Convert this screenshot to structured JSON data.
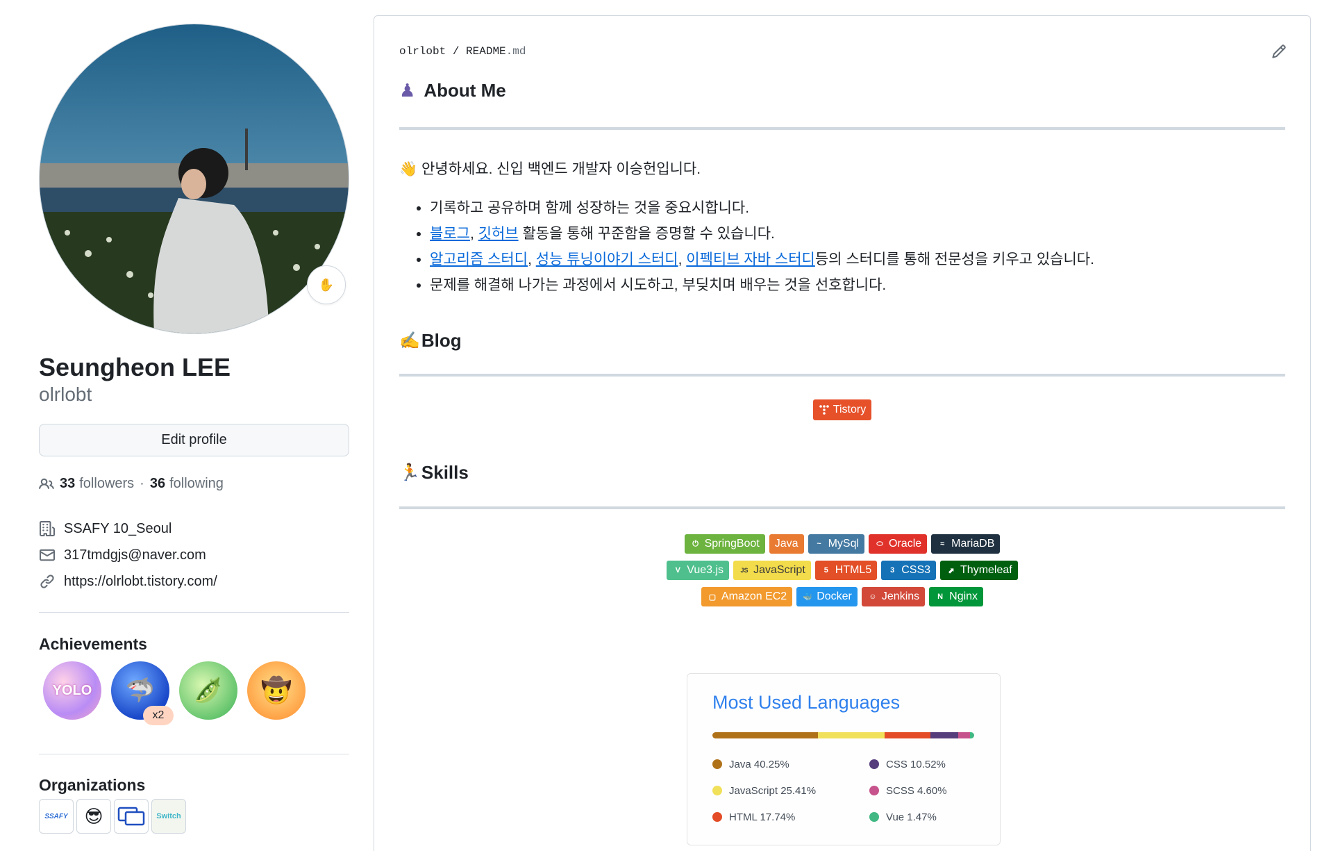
{
  "profile": {
    "full_name": "Seungheon LEE",
    "username": "olrlobt",
    "status_emoji": "✋",
    "edit_label": "Edit profile",
    "followers_count": "33",
    "followers_label": "followers",
    "separator": "·",
    "following_count": "36",
    "following_label": "following",
    "company": "SSAFY 10_Seoul",
    "email": "317tmdgjs@naver.com",
    "website": "https://olrlobt.tistory.com/"
  },
  "achievements": {
    "title": "Achievements",
    "items": [
      {
        "name": "yolo",
        "text": "YOLO"
      },
      {
        "name": "pull-shark",
        "text": "🦈",
        "count": "x2"
      },
      {
        "name": "pair-extraordinaire",
        "text": "🫛"
      },
      {
        "name": "quickdraw",
        "text": "🤠"
      }
    ]
  },
  "organizations": {
    "title": "Organizations",
    "items": [
      {
        "name": "ssafy",
        "text": "SSAFY"
      },
      {
        "name": "sunglasses",
        "text": "😎"
      },
      {
        "name": "monitor",
        "text": ""
      },
      {
        "name": "switch",
        "text": "Switch"
      }
    ]
  },
  "readme": {
    "breadcrumb_user": "olrlobt",
    "breadcrumb_sep": " / ",
    "breadcrumb_file": "README",
    "breadcrumb_ext": ".md",
    "about": {
      "icon": "♟",
      "title": "About Me"
    },
    "greeting": "👋 안녕하세요. 신입 백엔드 개발자 이승헌입니다.",
    "bullets": {
      "b1": "기록하고 공유하며 함께 성장하는 것을 중요시합니다.",
      "b2_link1": "블로그",
      "b2_comma": ", ",
      "b2_link2": "깃허브",
      "b2_rest": " 활동을 통해 꾸준함을 증명할 수 있습니다.",
      "b3_link1": "알고리즘 스터디",
      "b3_comma1": ", ",
      "b3_link2": "성능 튜닝이야기 스터디",
      "b3_comma2": ", ",
      "b3_link3": "이펙티브 자바 스터디",
      "b3_rest": "등의 스터디를 통해 전문성을 키우고 있습니다.",
      "b4": "문제를 해결해 나가는 과정에서 시도하고, 부딪치며 배우는 것을 선호합니다."
    },
    "blog": {
      "icon": "✍️",
      "title": "Blog",
      "badge": "Tistory"
    },
    "skills": {
      "icon": "🏃",
      "title": "Skills",
      "rows": [
        [
          {
            "label": "SpringBoot",
            "color": "#6DB33F",
            "logo": "⏻"
          },
          {
            "label": "Java",
            "color": "#E87A32",
            "logo": ""
          },
          {
            "label": "MySql",
            "color": "#4479A1",
            "logo": "~"
          },
          {
            "label": "Oracle",
            "color": "#E0322A",
            "logo": "⬭"
          },
          {
            "label": "MariaDB",
            "color": "#1F3140",
            "logo": "≈"
          }
        ],
        [
          {
            "label": "Vue3.js",
            "color": "#4FC08D",
            "logo": "V"
          },
          {
            "label": "JavaScript",
            "color": "#F2DC4B",
            "logo": "JS"
          },
          {
            "label": "HTML5",
            "color": "#E34F26",
            "logo": "5"
          },
          {
            "label": "CSS3",
            "color": "#1572B6",
            "logo": "3"
          },
          {
            "label": "Thymeleaf",
            "color": "#005F0F",
            "logo": "⬈"
          }
        ],
        [
          {
            "label": "Amazon EC2",
            "color": "#FF9900",
            "logo": "▢"
          },
          {
            "label": "Docker",
            "color": "#2496ED",
            "logo": "🐳"
          },
          {
            "label": "Jenkins",
            "color": "#D24939",
            "logo": "☺"
          },
          {
            "label": "Nginx",
            "color": "#009639",
            "logo": "N"
          }
        ]
      ]
    },
    "languages": {
      "title": "Most Used Languages",
      "items": [
        {
          "name": "Java",
          "percent": "40.25%",
          "value": 40.25,
          "color": "#B07219"
        },
        {
          "name": "CSS",
          "percent": "10.52%",
          "value": 10.52,
          "color": "#563D7C"
        },
        {
          "name": "JavaScript",
          "percent": "25.41%",
          "value": 25.41,
          "color": "#F1E05A"
        },
        {
          "name": "SCSS",
          "percent": "4.60%",
          "value": 4.6,
          "color": "#C6538C"
        },
        {
          "name": "HTML",
          "percent": "17.74%",
          "value": 17.74,
          "color": "#E34C26"
        },
        {
          "name": "Vue",
          "percent": "1.47%",
          "value": 1.47,
          "color": "#41B883"
        }
      ]
    }
  }
}
